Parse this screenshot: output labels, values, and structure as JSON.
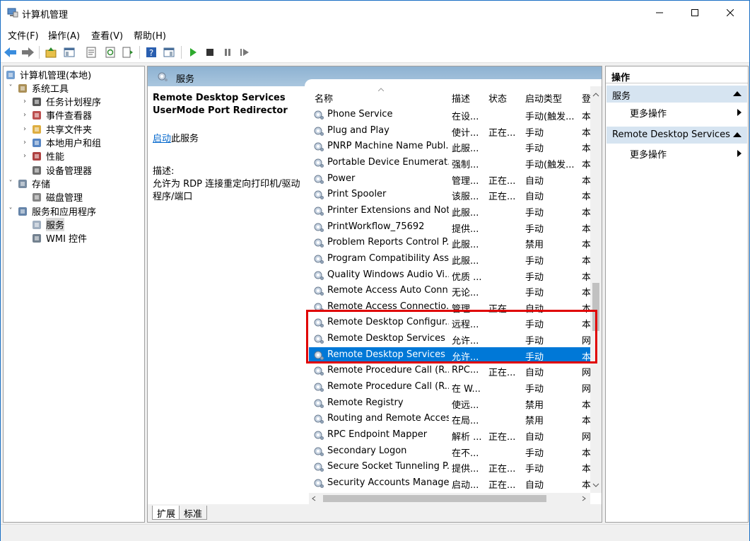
{
  "window": {
    "title": "计算机管理"
  },
  "menu": [
    "文件(F)",
    "操作(A)",
    "查看(V)",
    "帮助(H)"
  ],
  "tree": [
    {
      "label": "计算机管理(本地)",
      "icon": "computer-management-icon"
    },
    {
      "label": "系统工具",
      "icon": "tools-icon"
    },
    {
      "label": "任务计划程序",
      "icon": "clock-icon"
    },
    {
      "label": "事件查看器",
      "icon": "event-viewer-icon"
    },
    {
      "label": "共享文件夹",
      "icon": "shared-folder-icon"
    },
    {
      "label": "本地用户和组",
      "icon": "users-icon"
    },
    {
      "label": "性能",
      "icon": "performance-icon"
    },
    {
      "label": "设备管理器",
      "icon": "device-manager-icon"
    },
    {
      "label": "存储",
      "icon": "storage-icon"
    },
    {
      "label": "磁盘管理",
      "icon": "disk-icon"
    },
    {
      "label": "服务和应用程序",
      "icon": "services-apps-icon"
    },
    {
      "label": "服务",
      "icon": "services-icon"
    },
    {
      "label": "WMI 控件",
      "icon": "wmi-icon"
    }
  ],
  "center": {
    "header": "服务",
    "selected_service_line1": "Remote Desktop Services",
    "selected_service_line2": "UserMode Port Redirector",
    "start_link": "启动",
    "start_suffix": "此服务",
    "desc_label": "描述:",
    "desc_text": "允许为 RDP 连接重定向打印机/驱动程序/端口"
  },
  "columns": {
    "name": "名称",
    "desc": "描述",
    "status": "状态",
    "startup": "启动类型",
    "logon": "登"
  },
  "services": [
    {
      "name": "Phone Service",
      "desc": "在设...",
      "status": "",
      "startup": "手动(触发...",
      "logon": "本"
    },
    {
      "name": "Plug and Play",
      "desc": "使计...",
      "status": "正在...",
      "startup": "手动",
      "logon": "本"
    },
    {
      "name": "PNRP Machine Name Publ...",
      "desc": "此服...",
      "status": "",
      "startup": "手动",
      "logon": "本"
    },
    {
      "name": "Portable Device Enumerat...",
      "desc": "强制...",
      "status": "",
      "startup": "手动(触发...",
      "logon": "本"
    },
    {
      "name": "Power",
      "desc": "管理...",
      "status": "正在...",
      "startup": "自动",
      "logon": "本"
    },
    {
      "name": "Print Spooler",
      "desc": "该服...",
      "status": "正在...",
      "startup": "自动",
      "logon": "本"
    },
    {
      "name": "Printer Extensions and Noti...",
      "desc": "此服...",
      "status": "",
      "startup": "手动",
      "logon": "本"
    },
    {
      "name": "PrintWorkflow_75692",
      "desc": "提供...",
      "status": "",
      "startup": "手动",
      "logon": "本"
    },
    {
      "name": "Problem Reports Control P...",
      "desc": "此服...",
      "status": "",
      "startup": "禁用",
      "logon": "本"
    },
    {
      "name": "Program Compatibility Assi...",
      "desc": "此服...",
      "status": "",
      "startup": "手动",
      "logon": "本"
    },
    {
      "name": "Quality Windows Audio Vi...",
      "desc": "优质 ...",
      "status": "",
      "startup": "手动",
      "logon": "本"
    },
    {
      "name": "Remote Access Auto Conn...",
      "desc": "无论...",
      "status": "",
      "startup": "手动",
      "logon": "本"
    },
    {
      "name": "Remote Access Connectio...",
      "desc": "管理...",
      "status": "正在...",
      "startup": "自动",
      "logon": "本"
    },
    {
      "name": "Remote Desktop Configur...",
      "desc": "远程...",
      "status": "",
      "startup": "手动",
      "logon": "本"
    },
    {
      "name": "Remote Desktop Services",
      "desc": "允许...",
      "status": "",
      "startup": "手动",
      "logon": "网"
    },
    {
      "name": "Remote Desktop Services ...",
      "desc": "允许...",
      "status": "",
      "startup": "手动",
      "logon": "本"
    },
    {
      "name": "Remote Procedure Call (R...",
      "desc": "RPC...",
      "status": "正在...",
      "startup": "自动",
      "logon": "网"
    },
    {
      "name": "Remote Procedure Call (R...",
      "desc": "在 W...",
      "status": "",
      "startup": "手动",
      "logon": "网"
    },
    {
      "name": "Remote Registry",
      "desc": "使远...",
      "status": "",
      "startup": "禁用",
      "logon": "本"
    },
    {
      "name": "Routing and Remote Access",
      "desc": "在局...",
      "status": "",
      "startup": "禁用",
      "logon": "本"
    },
    {
      "name": "RPC Endpoint Mapper",
      "desc": "解析 ...",
      "status": "正在...",
      "startup": "自动",
      "logon": "网"
    },
    {
      "name": "Secondary Logon",
      "desc": "在不...",
      "status": "",
      "startup": "手动",
      "logon": "本"
    },
    {
      "name": "Secure Socket Tunneling P...",
      "desc": "提供...",
      "status": "正在...",
      "startup": "手动",
      "logon": "本"
    },
    {
      "name": "Security Accounts Manager",
      "desc": "启动...",
      "status": "正在...",
      "startup": "自动",
      "logon": "本"
    }
  ],
  "selected_index": 15,
  "tabs": [
    "扩展",
    "标准"
  ],
  "actions": {
    "header": "操作",
    "section1": "服务",
    "more1": "更多操作",
    "section2": "Remote Desktop Services ...",
    "more2": "更多操作"
  },
  "colors": {
    "selection": "#0078d7",
    "highlight_box": "#e00000",
    "pane_header": "#a9c6de",
    "action_section": "#d6e4f1"
  }
}
